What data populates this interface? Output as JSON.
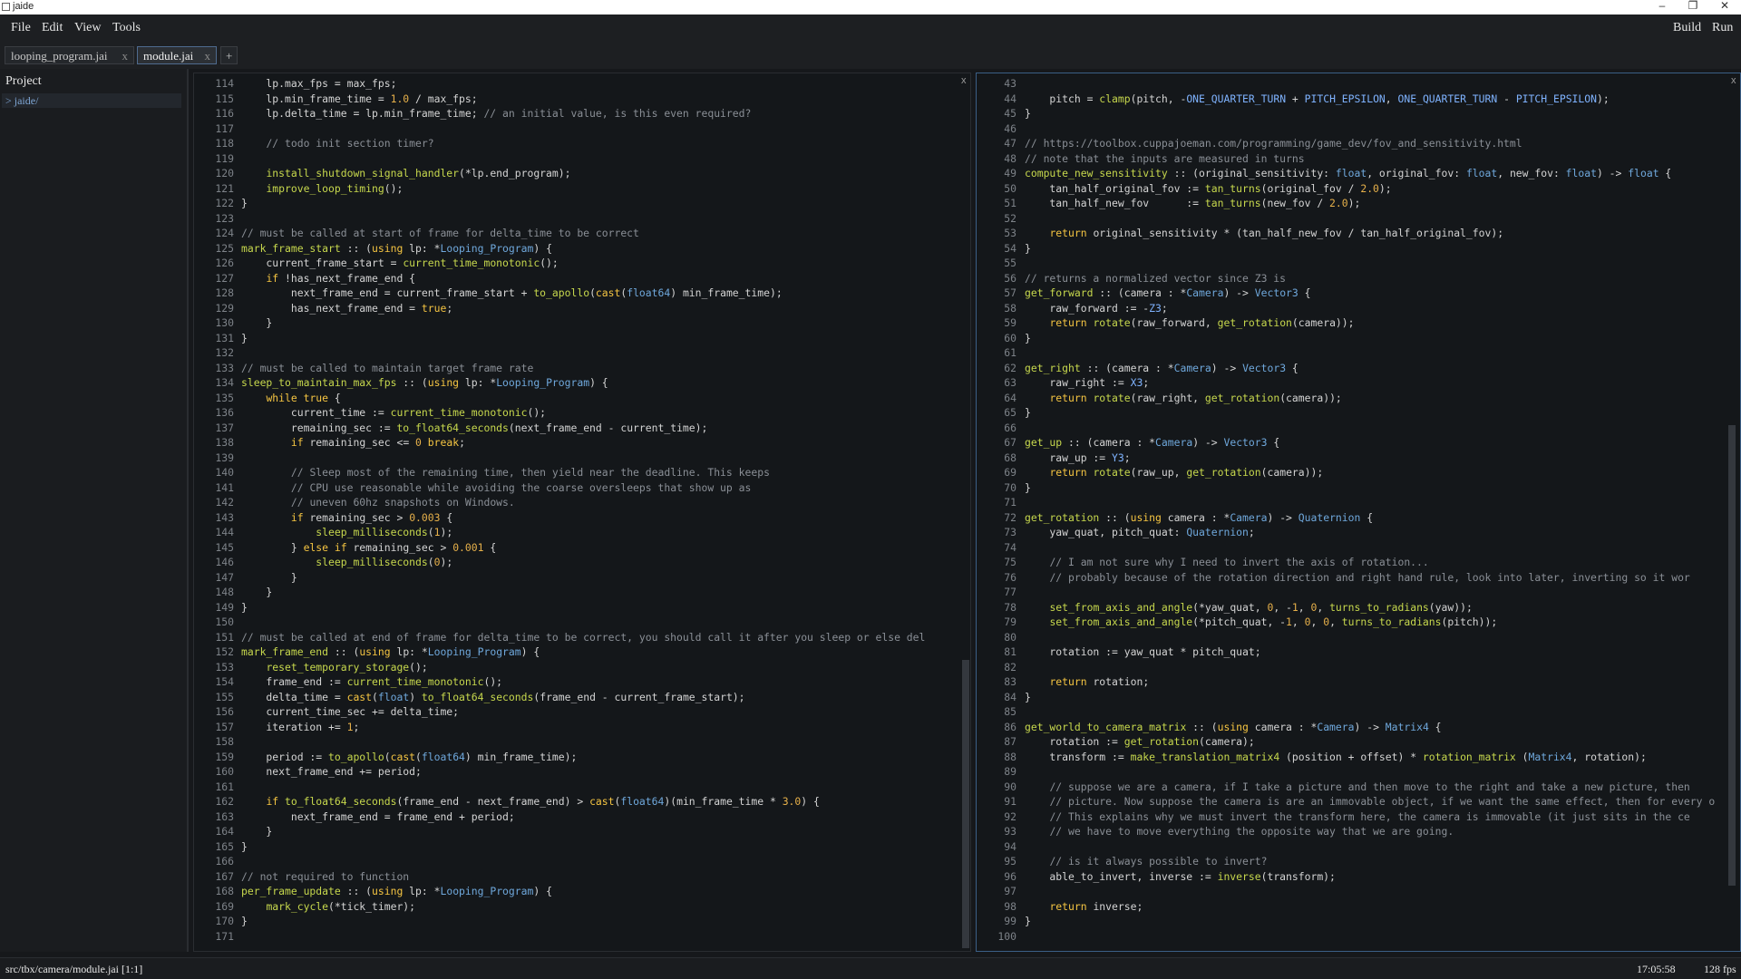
{
  "window": {
    "title": "jaide"
  },
  "menubar": {
    "items": [
      "File",
      "Edit",
      "View",
      "Tools"
    ],
    "build_label": "Build",
    "run_label": "Run"
  },
  "tabs": [
    {
      "label": "looping_program.jai",
      "close": "x",
      "active": false
    },
    {
      "label": "module.jai",
      "close": "x",
      "active": true
    }
  ],
  "new_tab_label": "+",
  "sidebar": {
    "title": "Project",
    "items": [
      "> jaide/"
    ]
  },
  "editor_left": {
    "close": "x",
    "first_line": 114,
    "last_line": 171,
    "lines": [
      "    lp.max_fps = max_fps;",
      "    lp.min_frame_time = 1.0 / max_fps;",
      "    lp.delta_time = lp.min_frame_time; // an initial value, is this even required?",
      "",
      "    // todo init section timer?",
      "",
      "    install_shutdown_signal_handler(*lp.end_program);",
      "    improve_loop_timing();",
      "}",
      "",
      "// must be called at start of frame for delta_time to be correct",
      "mark_frame_start :: (using lp: *Looping_Program) {",
      "    current_frame_start = current_time_monotonic();",
      "    if !has_next_frame_end {",
      "        next_frame_end = current_frame_start + to_apollo(cast(float64) min_frame_time);",
      "        has_next_frame_end = true;",
      "    }",
      "}",
      "",
      "// must be called to maintain target frame rate",
      "sleep_to_maintain_max_fps :: (using lp: *Looping_Program) {",
      "    while true {",
      "        current_time := current_time_monotonic();",
      "        remaining_sec := to_float64_seconds(next_frame_end - current_time);",
      "        if remaining_sec <= 0 break;",
      "",
      "        // Sleep most of the remaining time, then yield near the deadline. This keeps",
      "        // CPU use reasonable while avoiding the coarse oversleeps that show up as",
      "        // uneven 60hz snapshots on Windows.",
      "        if remaining_sec > 0.003 {",
      "            sleep_milliseconds(1);",
      "        } else if remaining_sec > 0.001 {",
      "            sleep_milliseconds(0);",
      "        }",
      "    }",
      "}",
      "",
      "// must be called at end of frame for delta_time to be correct, you should call it after you sleep or else del",
      "mark_frame_end :: (using lp: *Looping_Program) {",
      "    reset_temporary_storage();",
      "    frame_end := current_time_monotonic();",
      "    delta_time = cast(float) to_float64_seconds(frame_end - current_frame_start);",
      "    current_time_sec += delta_time;",
      "    iteration += 1;",
      "",
      "    period := to_apollo(cast(float64) min_frame_time);",
      "    next_frame_end += period;",
      "",
      "    if to_float64_seconds(frame_end - next_frame_end) > cast(float64)(min_frame_time * 3.0) {",
      "        next_frame_end = frame_end + period;",
      "    }",
      "}",
      "",
      "// not required to function",
      "per_frame_update :: (using lp: *Looping_Program) {",
      "    mark_cycle(*tick_timer);",
      "}",
      ""
    ]
  },
  "editor_right": {
    "close": "x",
    "first_line": 43,
    "last_line": 100,
    "lines": [
      "",
      "    pitch = clamp(pitch, -ONE_QUARTER_TURN + PITCH_EPSILON, ONE_QUARTER_TURN - PITCH_EPSILON);",
      "}",
      "",
      "// https://toolbox.cuppajoeman.com/programming/game_dev/fov_and_sensitivity.html",
      "// note that the inputs are measured in turns",
      "compute_new_sensitivity :: (original_sensitivity: float, original_fov: float, new_fov: float) -> float {",
      "    tan_half_original_fov := tan_turns(original_fov / 2.0);",
      "    tan_half_new_fov      := tan_turns(new_fov / 2.0);",
      "",
      "    return original_sensitivity * (tan_half_new_fov / tan_half_original_fov);",
      "}",
      "",
      "// returns a normalized vector since Z3 is",
      "get_forward :: (camera : *Camera) -> Vector3 {",
      "    raw_forward := -Z3;",
      "    return rotate(raw_forward, get_rotation(camera));",
      "}",
      "",
      "get_right :: (camera : *Camera) -> Vector3 {",
      "    raw_right := X3;",
      "    return rotate(raw_right, get_rotation(camera));",
      "}",
      "",
      "get_up :: (camera : *Camera) -> Vector3 {",
      "    raw_up := Y3;",
      "    return rotate(raw_up, get_rotation(camera));",
      "}",
      "",
      "get_rotation :: (using camera : *Camera) -> Quaternion {",
      "    yaw_quat, pitch_quat: Quaternion;",
      "",
      "    // I am not sure why I need to invert the axis of rotation...",
      "    // probably because of the rotation direction and right hand rule, look into later, inverting so it wor",
      "",
      "    set_from_axis_and_angle(*yaw_quat, 0, -1, 0, turns_to_radians(yaw));",
      "    set_from_axis_and_angle(*pitch_quat, -1, 0, 0, turns_to_radians(pitch));",
      "",
      "    rotation := yaw_quat * pitch_quat;",
      "",
      "    return rotation;",
      "}",
      "",
      "get_world_to_camera_matrix :: (using camera : *Camera) -> Matrix4 {",
      "    rotation := get_rotation(camera);",
      "    transform := make_translation_matrix4 (position + offset) * rotation_matrix (Matrix4, rotation);",
      "",
      "    // suppose we are a camera, if I take a picture and then move to the right and take a new picture, then",
      "    // picture. Now suppose the camera is are an immovable object, if we want the same effect, then for every o",
      "    // This explains why we must invert the transform here, the camera is immovable (it just sits in the ce",
      "    // we have to move everything the opposite way that we are going.",
      "",
      "    // is it always possible to invert?",
      "    able_to_invert, inverse := inverse(transform);",
      "",
      "    return inverse;",
      "}",
      ""
    ]
  },
  "status": {
    "path": "src/tbx/camera/module.jai  [1:1]",
    "time": "17:05:58",
    "fps": "128 fps"
  }
}
